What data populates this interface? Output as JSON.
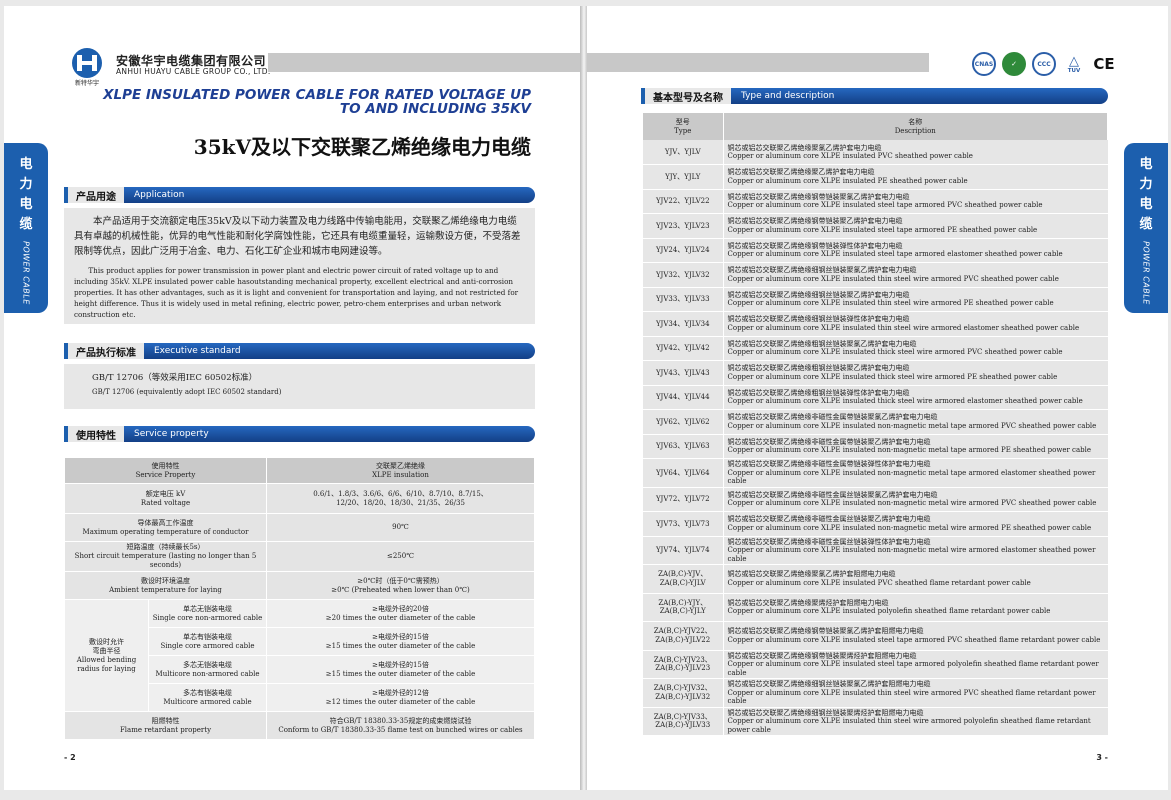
{
  "company": {
    "cn": "安徽华宇电缆集团有限公司",
    "en": "ANHUI HUAYU CABLE GROUP CO., LTD.",
    "logo_text": "新特华宇"
  },
  "certs": [
    "CNAS",
    "CCC",
    "TUV",
    "CE"
  ],
  "title": {
    "en": "XLPE INSULATED POWER CABLE FOR RATED VOLTAGE UP TO AND INCLUDING 35KV",
    "cn": "35kV及以下交联聚乙烯绝缘电力电缆"
  },
  "sidetab": {
    "chars": [
      "电",
      "力",
      "电",
      "缆"
    ],
    "en": "POWER CABLE"
  },
  "application": {
    "cn": "产品用途",
    "en": "Application",
    "text_cn": "本产品适用于交流额定电压35kV及以下动力装置及电力线路中传输电能用，交联聚乙烯绝缘电力电缆具有卓越的机械性能，优异的电气性能和耐化学腐蚀性能，它还具有电缆重量轻，运输敷设方便，不受落差限制等优点，因此广泛用于冶金、电力、石化工矿企业和城市电网建设等。",
    "text_en": "This product applies for power transmission in power plant and electric power circuit of rated voltage up to and including 35kV. XLPE insulated power cable hasoutstanding mechanical property, excellent electrical and anti-corrosion properties. It has other advantages, such as it is light and convenient for transportation and laying, and not restricted for height difference. Thus it is widely used in metal refining, electric power, petro-chem enterprises and urban network construction etc."
  },
  "standard": {
    "cn": "产品执行标准",
    "en": "Executive standard",
    "text_cn": "GB/T 12706（等效采用IEC 60502标准）",
    "text_en": "GB/T 12706 (equivalently adopt IEC 60502 standard)"
  },
  "service": {
    "cn": "使用特性",
    "en": "Service property",
    "head_left": [
      "使用特性",
      "Service Property"
    ],
    "head_right": [
      "交联聚乙烯绝缘",
      "XLPE insulation"
    ],
    "rows": [
      {
        "l": [
          "额定电压 kV",
          "Rated voltage"
        ],
        "r": [
          "0.6/1、1.8/3、3.6/6、6/6、6/10、8.7/10、8.7/15、",
          "12/20、18/20、18/30、21/35、26/35"
        ]
      },
      {
        "l": [
          "导体最高工作温度",
          "Maximum operating temperature of conductor"
        ],
        "r": [
          "90℃"
        ]
      },
      {
        "l": [
          "短路温度（持续最长5s）",
          "Short circuit temperature (lasting no longer than 5 seconds)"
        ],
        "r": [
          "≤250℃"
        ]
      },
      {
        "l": [
          "敷设时环境温度",
          "Ambient temperature for laying"
        ],
        "r": [
          "≥0℃时（低于0℃需预热）",
          "≥0℃ (Preheated when lower than 0℃)"
        ]
      }
    ],
    "bend_label": [
      "敷设时允许",
      "弯曲半径",
      "Allowed bending",
      "radius for laying"
    ],
    "bend_rows": [
      {
        "l": [
          "单芯无铠装电缆",
          "Single core non-armored cable"
        ],
        "r": [
          "≥电缆外径的20倍",
          "≥20 times the outer diameter of the cable"
        ]
      },
      {
        "l": [
          "单芯有铠装电缆",
          "Single core armored cable"
        ],
        "r": [
          "≥电缆外径的15倍",
          "≥15 times the outer diameter of the cable"
        ]
      },
      {
        "l": [
          "多芯无铠装电缆",
          "Multicore non-armored cable"
        ],
        "r": [
          "≥电缆外径的15倍",
          "≥15 times the outer diameter of the cable"
        ]
      },
      {
        "l": [
          "多芯有铠装电缆",
          "Multicore armored cable"
        ],
        "r": [
          "≥电缆外径的12倍",
          "≥12 times the outer diameter of the cable"
        ]
      }
    ],
    "flame": {
      "l": [
        "阻燃特性",
        "Flame retardant property"
      ],
      "r": [
        "符合GB/T 18380.33-35规定的成束燃烧试验",
        "Conform to GB/T 18380.33-35 flame test on bunched wires or cables"
      ]
    }
  },
  "types": {
    "cn": "基本型号及名称",
    "en": "Type and description",
    "head_model": [
      "型号",
      "Type"
    ],
    "head_name": [
      "名称",
      "Description"
    ],
    "rows": [
      {
        "m": [
          "YJV、YJLV"
        ],
        "cn": "铜芯或铝芯交联聚乙烯绝缘聚氯乙烯护套电力电缆",
        "en": "Copper or aluminum core XLPE insulated PVC sheathed power cable"
      },
      {
        "m": [
          "YJY、YJLY"
        ],
        "cn": "铜芯或铝芯交联聚乙烯绝缘聚乙烯护套电力电缆",
        "en": "Copper or aluminum core XLPE insulated PE sheathed power cable"
      },
      {
        "m": [
          "YJV22、YJLV22"
        ],
        "cn": "铜芯或铝芯交联聚乙烯绝缘钢带铠装聚氯乙烯护套电力电缆",
        "en": "Copper or aluminum core XLPE insulated steel tape armored PVC sheathed power cable"
      },
      {
        "m": [
          "YJV23、YJLV23"
        ],
        "cn": "铜芯或铝芯交联聚乙烯绝缘钢带铠装聚乙烯护套电力电缆",
        "en": "Copper or aluminum core XLPE insulated steel tape armored PE sheathed power cable"
      },
      {
        "m": [
          "YJV24、YJLV24"
        ],
        "cn": "铜芯或铝芯交联聚乙烯绝缘钢带铠装弹性体护套电力电缆",
        "en": "Copper or aluminum core XLPE insulated steel tape armored elastomer sheathed power cable"
      },
      {
        "m": [
          "YJV32、YJLV32"
        ],
        "cn": "铜芯或铝芯交联聚乙烯绝缘细钢丝铠装聚氯乙烯护套电力电缆",
        "en": "Copper or aluminum core XLPE insulated thin steel wire armored PVC sheathed power cable"
      },
      {
        "m": [
          "YJV33、YJLV33"
        ],
        "cn": "铜芯或铝芯交联聚乙烯绝缘细钢丝铠装聚乙烯护套电力电缆",
        "en": "Copper or aluminum core XLPE insulated thin steel wire armored PE sheathed power cable"
      },
      {
        "m": [
          "YJV34、YJLV34"
        ],
        "cn": "铜芯或铝芯交联聚乙烯绝缘细钢丝铠装弹性体护套电力电缆",
        "en": "Copper or aluminum core XLPE insulated thin steel wire armored elastomer sheathed power cable"
      },
      {
        "m": [
          "YJV42、YJLV42"
        ],
        "cn": "铜芯或铝芯交联聚乙烯绝缘粗钢丝铠装聚氯乙烯护套电力电缆",
        "en": "Copper or aluminum core XLPE insulated thick steel wire armored PVC sheathed power cable"
      },
      {
        "m": [
          "YJV43、YJLV43"
        ],
        "cn": "铜芯或铝芯交联聚乙烯绝缘粗钢丝铠装聚乙烯护套电力电缆",
        "en": "Copper or aluminum core XLPE insulated thick steel wire armored PE sheathed power cable"
      },
      {
        "m": [
          "YJV44、YJLV44"
        ],
        "cn": "铜芯或铝芯交联聚乙烯绝缘粗钢丝铠装弹性体护套电力电缆",
        "en": "Copper or aluminum core XLPE insulated thick steel wire armored elastomer sheathed power cable"
      },
      {
        "m": [
          "YJV62、YJLV62"
        ],
        "cn": "铜芯或铝芯交联聚乙烯绝缘非磁性金属带铠装聚氯乙烯护套电力电缆",
        "en": "Copper or aluminum core XLPE insulated non-magnetic metal tape armored PVC sheathed power cable"
      },
      {
        "m": [
          "YJV63、YJLV63"
        ],
        "cn": "铜芯或铝芯交联聚乙烯绝缘非磁性金属带铠装聚乙烯护套电力电缆",
        "en": "Copper or aluminum core XLPE insulated non-magnetic metal tape armored PE sheathed power cable"
      },
      {
        "m": [
          "YJV64、YJLV64"
        ],
        "cn": "铜芯或铝芯交联聚乙烯绝缘非磁性金属带铠装弹性体护套电力电缆",
        "en": "Copper or aluminum core XLPE insulated non-magnetic metal tape armored elastomer sheathed power cable"
      },
      {
        "m": [
          "YJV72、YJLV72"
        ],
        "cn": "铜芯或铝芯交联聚乙烯绝缘非磁性金属丝铠装聚氯乙烯护套电力电缆",
        "en": "Copper or aluminum core XLPE insulated non-magnetic metal wire armored PVC sheathed power cable"
      },
      {
        "m": [
          "YJV73、YJLV73"
        ],
        "cn": "铜芯或铝芯交联聚乙烯绝缘非磁性金属丝铠装聚乙烯护套电力电缆",
        "en": "Copper or aluminum core XLPE insulated non-magnetic metal wire armored PE sheathed power cable"
      },
      {
        "m": [
          "YJV74、YJLV74"
        ],
        "cn": "铜芯或铝芯交联聚乙烯绝缘非磁性金属丝铠装弹性体护套电力电缆",
        "en": "Copper or aluminum core XLPE insulated non-magnetic metal wire armored elastomer sheathed power cable"
      },
      {
        "m": [
          "ZA(B,C)-YJV、",
          "ZA(B,C)-YJLV"
        ],
        "cn": "铜芯或铝芯交联聚乙烯绝缘聚氯乙烯护套阻燃电力电缆",
        "en": "Copper or aluminum core XLPE insulated PVC sheathed flame retardant power cable"
      },
      {
        "m": [
          "ZA(B,C)-YJY、",
          "ZA(B,C)-YJLY"
        ],
        "cn": "铜芯或铝芯交联聚乙烯绝缘聚烯烃护套阻燃电力电缆",
        "en": "Copper or aluminum core XLPE insulated polyolefin sheathed flame retardant power cable"
      },
      {
        "m": [
          "ZA(B,C)-YJV22、",
          "ZA(B,C)-YJLV22"
        ],
        "cn": "铜芯或铝芯交联聚乙烯绝缘钢带铠装聚氯乙烯护套阻燃电力电缆",
        "en": "Copper or aluminum core XLPE insulated steel tape armored PVC sheathed flame retardant power cable"
      },
      {
        "m": [
          "ZA(B,C)-YJV23、",
          "ZA(B,C)-YJLV23"
        ],
        "cn": "铜芯或铝芯交联聚乙烯绝缘钢带铠装聚烯烃护套阻燃电力电缆",
        "en": "Copper or aluminum core XLPE insulated steel tape armored polyolefin sheathed flame retardant power cable"
      },
      {
        "m": [
          "ZA(B,C)-YJV32、",
          "ZA(B,C)-YJLV32"
        ],
        "cn": "铜芯或铝芯交联聚乙烯绝缘细钢丝铠装聚氯乙烯护套阻燃电力电缆",
        "en": "Copper or aluminum core XLPE insulated thin steel wire armored PVC sheathed flame retardant power cable"
      },
      {
        "m": [
          "ZA(B,C)-YJV33、",
          "ZA(B,C)-YJLV33"
        ],
        "cn": "铜芯或铝芯交联聚乙烯绝缘细钢丝铠装聚烯烃护套阻燃电力电缆",
        "en": "Copper or aluminum core XLPE insulated thin steel wire armored polyolefin sheathed flame retardant power cable"
      }
    ]
  },
  "page_left": "- 2",
  "page_right": "3 -"
}
